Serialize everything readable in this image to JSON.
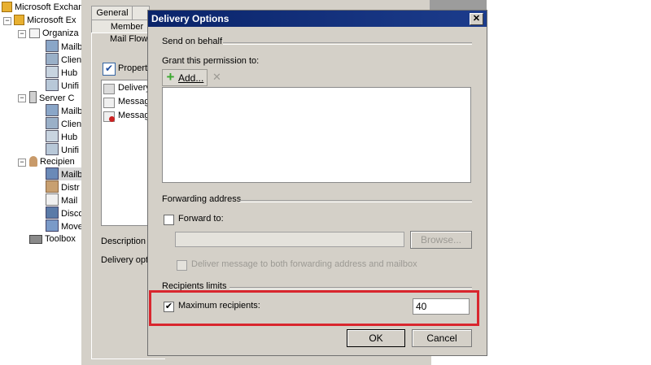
{
  "tree": {
    "root": "Microsoft Exchan",
    "org_root": "Microsoft Ex",
    "organization": "Organiza",
    "org_children": [
      "Mailb",
      "Clien",
      "Hub",
      "Unifi"
    ],
    "server": "Server C",
    "server_children": [
      "Mailb",
      "Clien",
      "Hub",
      "Unifi"
    ],
    "recipient": "Recipien",
    "recipient_children": [
      "Mailb",
      "Distr",
      "Mail",
      "Disco",
      "Move"
    ],
    "toolbox": "Toolbox"
  },
  "properties_window": {
    "tabs": [
      "General",
      "Member",
      "Mail Flow"
    ],
    "properties_label": "Propert",
    "list_items": [
      "Delivery",
      "Message",
      "Message"
    ],
    "description_label": "Description",
    "delivery_label": "Delivery opt"
  },
  "dialog": {
    "title": "Delivery Options",
    "close_glyph": "✕",
    "send_on_behalf": {
      "section": "Send on behalf",
      "grant_label": "Grant this permission to:",
      "add_label": "Add...",
      "remove_glyph": "✕"
    },
    "forwarding": {
      "section": "Forwarding address",
      "forward_to_label": "Forward to:",
      "forward_to_value": "",
      "browse_label": "Browse...",
      "deliver_both_label": "Deliver message to both forwarding address and mailbox"
    },
    "recipient_limits": {
      "section": "Recipients limits",
      "max_label": "Maximum recipients:",
      "max_checked": true,
      "max_value": "40",
      "check_glyph": "✔"
    },
    "ok_label": "OK",
    "cancel_label": "Cancel"
  },
  "colors": {
    "highlight_border": "#d9262e",
    "titlebar": "#0a246a",
    "add_icon": "#3aa82e"
  }
}
